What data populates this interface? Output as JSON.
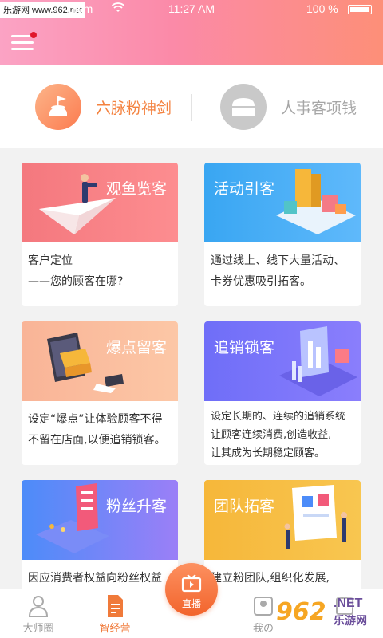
{
  "status_bar": {
    "site_badge": "乐游网 www.962.net",
    "carrier": "dium",
    "time": "11:27 AM",
    "battery": "100 %"
  },
  "tabs": [
    {
      "label": "六脉粉神剑",
      "active": true
    },
    {
      "label": "人事客项钱",
      "active": false
    }
  ],
  "cards": [
    {
      "title": "观鱼览客",
      "desc_line1": "客户定位",
      "desc_line2": "——您的顾客在哪?"
    },
    {
      "title": "活动引客",
      "desc_line1": "通过线上、线下大量活动、",
      "desc_line2": "卡券优惠吸引拓客。"
    },
    {
      "title": "爆点留客",
      "desc_line1": "设定“爆点”让体验顾客不得",
      "desc_line2": "不留在店面,以便追销锁客。"
    },
    {
      "title": "追销锁客",
      "desc_line1": "设定长期的、连续的追销系统",
      "desc_line2": "让顾客连续消费,创造收益,",
      "desc_line3": "让其成为长期稳定顾客。"
    },
    {
      "title": "粉丝升客",
      "desc_line1": "因应消费者权益向粉丝权益"
    },
    {
      "title": "团队拓客",
      "desc_line1": "建立粉团队,组织化发展,"
    }
  ],
  "bottom_nav": {
    "item1": "大师圈",
    "item2": "智经营",
    "live": "直播",
    "item4": "我の",
    "item5": ""
  },
  "watermark": {
    "num": "962",
    "net": ".NET",
    "cn": "乐游网"
  },
  "colors": {
    "header_gradient_start": "#fba3c4",
    "header_gradient_end": "#fd8f78",
    "accent_orange": "#f4823f"
  }
}
